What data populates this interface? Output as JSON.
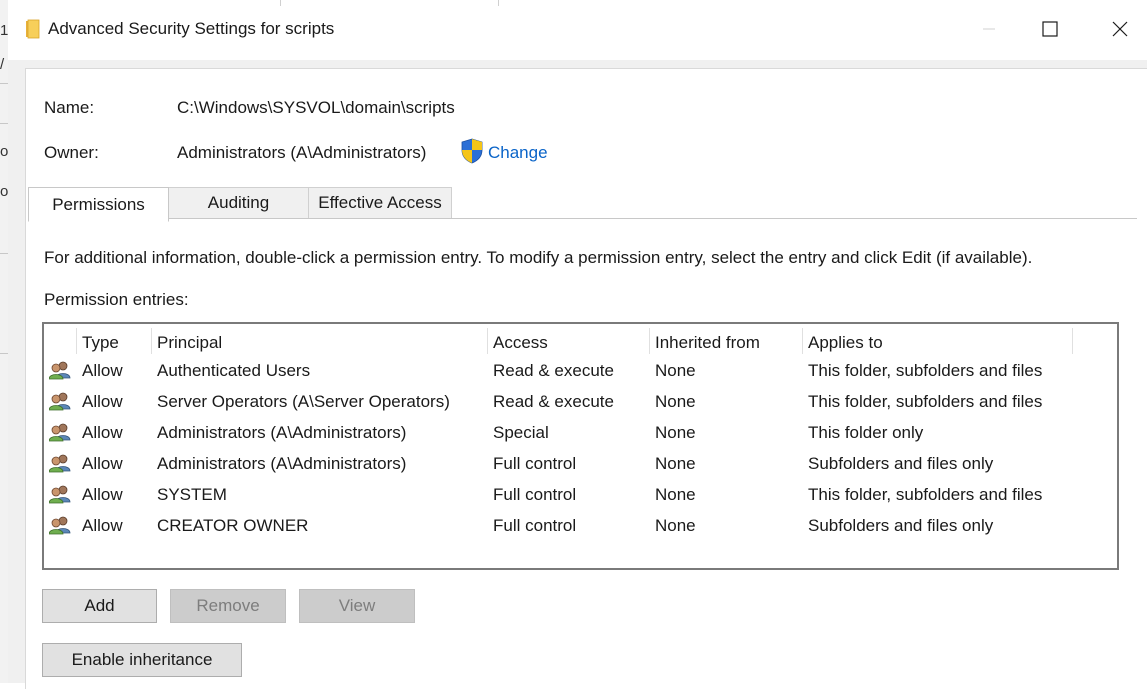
{
  "window": {
    "title": "Advanced Security Settings for scripts"
  },
  "info": {
    "name_label": "Name:",
    "name_value": "C:\\Windows\\SYSVOL\\domain\\scripts",
    "owner_label": "Owner:",
    "owner_value": "Administrators (A\\Administrators)",
    "change_label": "Change"
  },
  "tabs": [
    {
      "label": "Permissions",
      "active": true
    },
    {
      "label": "Auditing",
      "active": false
    },
    {
      "label": "Effective Access",
      "active": false
    }
  ],
  "instructions": "For additional information, double-click a permission entry. To modify a permission entry, select the entry and click Edit (if available).",
  "entries_label": "Permission entries:",
  "columns": [
    "Type",
    "Principal",
    "Access",
    "Inherited from",
    "Applies to"
  ],
  "rows": [
    {
      "type": "Allow",
      "principal": "Authenticated Users",
      "access": "Read & execute",
      "inherited": "None",
      "applies": "This folder, subfolders and files"
    },
    {
      "type": "Allow",
      "principal": "Server Operators (A\\Server Operators)",
      "access": "Read & execute",
      "inherited": "None",
      "applies": "This folder, subfolders and files"
    },
    {
      "type": "Allow",
      "principal": "Administrators (A\\Administrators)",
      "access": "Special",
      "inherited": "None",
      "applies": "This folder only"
    },
    {
      "type": "Allow",
      "principal": "Administrators (A\\Administrators)",
      "access": "Full control",
      "inherited": "None",
      "applies": "Subfolders and files only"
    },
    {
      "type": "Allow",
      "principal": "SYSTEM",
      "access": "Full control",
      "inherited": "None",
      "applies": "This folder, subfolders and files"
    },
    {
      "type": "Allow",
      "principal": "CREATOR OWNER",
      "access": "Full control",
      "inherited": "None",
      "applies": "Subfolders and files only"
    }
  ],
  "buttons": {
    "add": "Add",
    "remove": "Remove",
    "view": "View",
    "enable_inheritance": "Enable inheritance"
  },
  "background_fragments": [
    "1",
    "/",
    "o",
    "ol"
  ],
  "colors": {
    "link": "#0a64c8",
    "shield_blue": "#2b6fd6",
    "shield_yellow": "#f5c518"
  }
}
